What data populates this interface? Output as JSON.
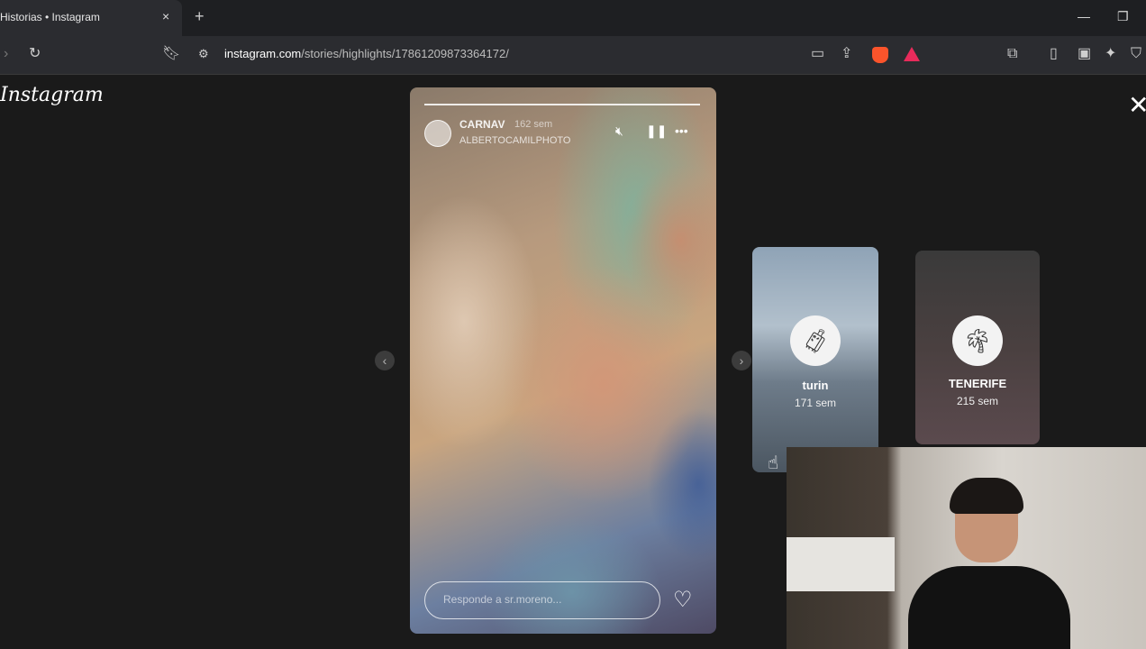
{
  "browser": {
    "tab_title": "Historias • Instagram",
    "tab_close": "×",
    "new_tab": "+",
    "url_host": "instagram.com",
    "url_path": "/stories/highlights/17861209873364172/"
  },
  "page": {
    "logo": "Instagram",
    "close": "✕"
  },
  "story": {
    "username": "CARNAV",
    "time": "162 sem",
    "subtitle": "ALBERTOCAMILPHOTO",
    "reply_placeholder": "Responde a sr.moreno...",
    "heart": "♡"
  },
  "highlights": [
    {
      "name": "turin",
      "time": "171 sem",
      "icon": "luggage-icon"
    },
    {
      "name": "TENERIFE",
      "time": "215 sem",
      "icon": "palm-tree-icon"
    }
  ],
  "colors": {
    "brave": "#fb542b",
    "rewards": "#e82b5b",
    "page_bg": "#1a1a1a"
  }
}
